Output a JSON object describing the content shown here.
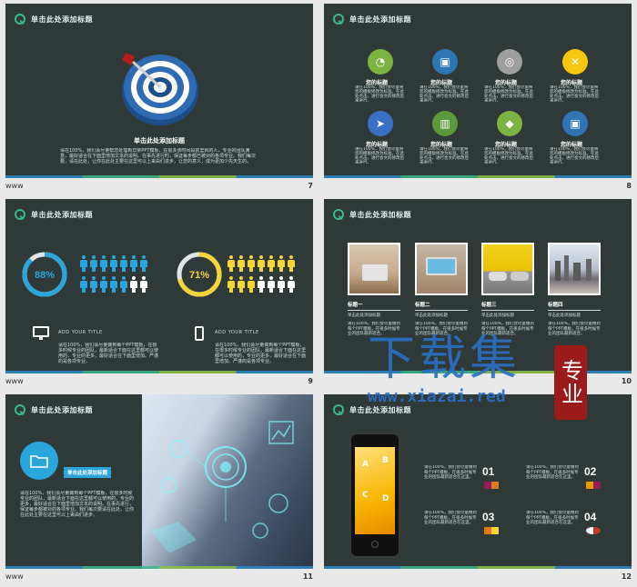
{
  "colors": {
    "slide_bg": "#2f3a38",
    "accent_green": "#39b889",
    "accent_blue": "#2c8acb",
    "accent_yellow": "#f3d53a",
    "lime": "#8bc34a",
    "watermark_blue": "#2a6fc2",
    "watermark_red": "#9b1b1b"
  },
  "slides": [
    {
      "number": "7",
      "title": "单击此处添加标题",
      "subtitle": "单击此处添加标题",
      "body": "请在100%，我们会尽量帮您处理到日常PPT模板，在很多该时间段前里就的人，专业的团队满意，最好适合在下面里增加文本的说明。在事先进行时，保证每步都已被对的各项专业。我们每次要，请在此处，让你在此处主要在这里可以上来由们进步，让您的意义，成为更加少先天生的。",
      "footer_left": "www"
    },
    {
      "number": "8",
      "title": "单击此处添加标题",
      "items": [
        {
          "icon": "speedometer-icon",
          "color": "#7cb342",
          "label": "您的标题",
          "text": "请在100%，我们会尽量将您的模板修改为标准。在此处点击，进行会文的修改后来进行。"
        },
        {
          "icon": "briefcase-icon",
          "color": "#2e75b6",
          "label": "您的标题",
          "text": "请在100%，我们会尽量将您的模板修改为标准。在此处点击，进行会文的修改后来进行。"
        },
        {
          "icon": "target-icon",
          "color": "#9e9e9e",
          "label": "您的标题",
          "text": "请在100%，我们会尽量将您的模板修改为标准。在此处点击，进行会文的修改后来进行。"
        },
        {
          "icon": "tools-icon",
          "color": "#f9c710",
          "label": "您的标题",
          "text": "请在100%，我们会尽量将您的模板修改为标准。在此处点击，进行会文的修改后来进行。"
        },
        {
          "icon": "paper-plane-icon",
          "color": "#3a6fc8",
          "label": "您的标题",
          "text": "请在100%，我们会尽量将您的模板修改为标准。在此处点击，进行会文的修改后来进行。"
        },
        {
          "icon": "map-icon",
          "color": "#5b9a3c",
          "label": "您的标题",
          "text": "请在100%，我们会尽量将您的模板修改为标准。在此处点击，进行会文的修改后来进行。"
        },
        {
          "icon": "graduation-cap-icon",
          "color": "#7cb342",
          "label": "您的标题",
          "text": "请在100%，我们会尽量将您的模板修改为标准。在此处点击，进行会文的修改后来进行。"
        },
        {
          "icon": "briefcase-icon",
          "color": "#2e75b6",
          "label": "您的标题",
          "text": "请在100%，我们会尽量将您的模板修改为标准。在此处点击，进行会文的修改后来进行。"
        }
      ]
    },
    {
      "number": "9",
      "title": "单击此处添加标题",
      "stat1": {
        "value": "88%",
        "fraction": 0.88,
        "color": "#2aa6dc"
      },
      "stat2": {
        "value": "71%",
        "fraction": 0.71,
        "color": "#f3d53a"
      },
      "people1_highlight": 8,
      "people2_highlight": 8,
      "people_total": 14,
      "block1": {
        "heading": "ADD YOUR TITLE",
        "text": "请在100%，我们会尽量做到每个PPT模板，在很多时候专业的团队，最新适合下面在这里都可以使用的，专业的更多，最好适合在下面里增加。严谨的是各项专业。"
      },
      "block2": {
        "heading": "ADD YOUR TITLE",
        "text": "请在100%，我们会尽量做到每个PPT模板，在很多时候专业的团队，最新适合下面在这里都可以使用的，专业的更多，最好适合在下面里增加。严谨的是各项专业。"
      }
    },
    {
      "number": "10",
      "title": "单击此处添加标题",
      "photos": [
        {
          "label": "标题一",
          "sub": "单击此处添加标题",
          "text": "请在100%，我们会尽量做到每个PPT模板，在很多时候专业的团队最新适合。"
        },
        {
          "label": "标题二",
          "sub": "单击此处添加标题",
          "text": "请在100%，我们会尽量做到每个PPT模板，在很多时候专业的团队最新适合。"
        },
        {
          "label": "标题三",
          "sub": "单击此处添加标题",
          "text": "请在100%，我们会尽量做到每个PPT模板，在很多时候专业的团队最新适合。"
        },
        {
          "label": "标题四",
          "sub": "单击此处添加标题",
          "text": "请在100%，我们会尽量做到每个PPT模板，在很多时候专业的团队最新适合。"
        }
      ]
    },
    {
      "number": "11",
      "title": "单击此处添加标题",
      "tag": "单击此处添加标题",
      "text": "请在100%，我们会尽量做到每个PPT模板，在很多时候专业的团队，最新适合下面在这里都可以使用的，专业的更多，最好适合在下面里增加文本的说明。在事先进行，保证每步都被对的各项专业。我们每次要请在此处，让你在此处主要在这里可以上来由们进步。"
    },
    {
      "number": "12",
      "title": "单击此处添加标题",
      "phone_letters": [
        "A",
        "B",
        "C",
        "D"
      ],
      "blocks": [
        {
          "num": "01",
          "text": "请在100%，我们会尽量做到每个PPT模板，在很多时候专业的团队最新适合在这里。"
        },
        {
          "num": "02",
          "text": "请在100%，我们会尽量做到每个PPT模板，在很多时候专业的团队最新适合在这里。"
        },
        {
          "num": "03",
          "text": "请在100%，我们会尽量做到每个PPT模板，在很多时候专业的团队最新适合在这里。"
        },
        {
          "num": "04",
          "text": "请在100%，我们会尽量做到每个PPT模板，在很多时候专业的团队最新适合在这里。"
        }
      ]
    }
  ],
  "watermark": {
    "main": "下载集",
    "tag": "专业",
    "url": "www.xiazai.red"
  }
}
